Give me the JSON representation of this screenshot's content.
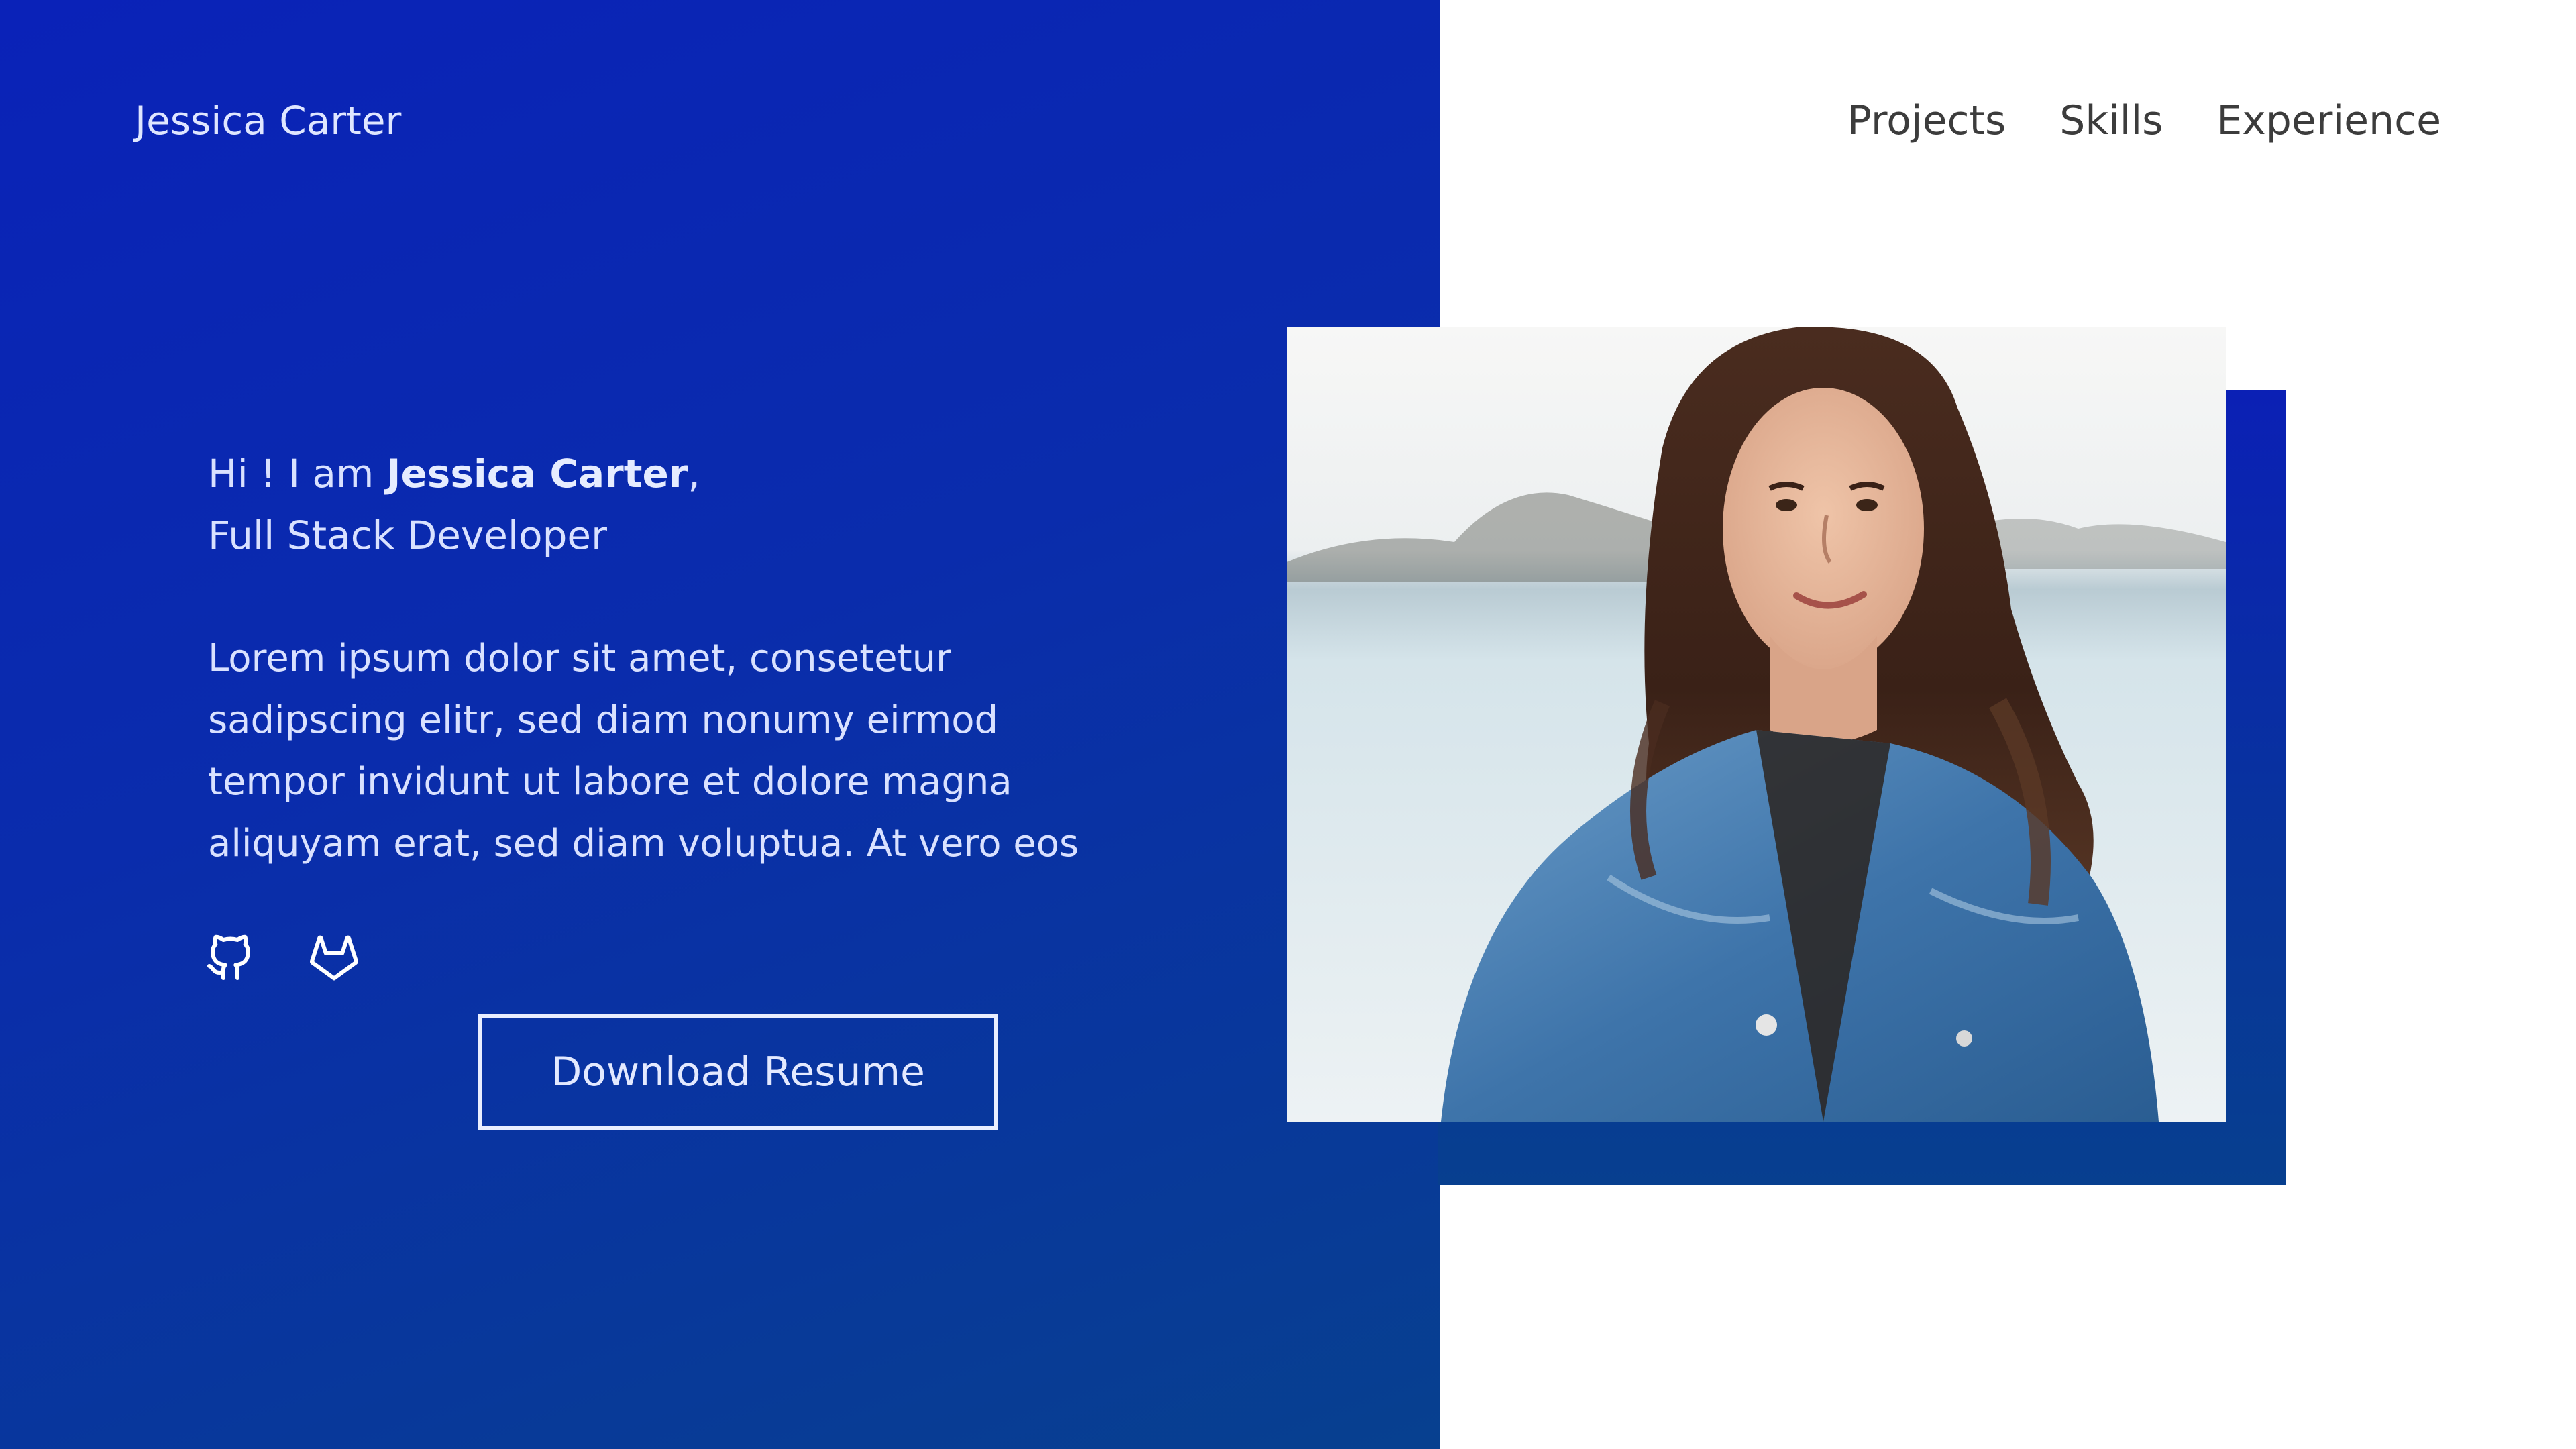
{
  "brand": {
    "name": "Jessica Carter"
  },
  "nav": {
    "items": [
      {
        "label": "Projects"
      },
      {
        "label": "Skills"
      },
      {
        "label": "Experience"
      }
    ]
  },
  "hero": {
    "greeting_prefix": "Hi ! I am ",
    "name": "Jessica Carter",
    "greeting_suffix": ",",
    "role": "Full Stack Developer",
    "bio": "Lorem ipsum dolor sit amet, consetetur\nsadipscing elitr, sed diam nonumy eirmod\ntempor invidunt ut labore et dolore magna\naliquyam erat, sed diam voluptua. At vero eos",
    "resume_button_label": "Download Resume"
  },
  "social": {
    "icons": [
      "github-icon",
      "gitlab-icon"
    ]
  },
  "colors": {
    "accent_blue": "#0a22b8",
    "deep_blue": "#07408f",
    "hero_text": "#d9e1ff",
    "nav_text": "#3c3c3c",
    "background": "#ffffff"
  },
  "photo": {
    "subject": "portrait-photo"
  }
}
